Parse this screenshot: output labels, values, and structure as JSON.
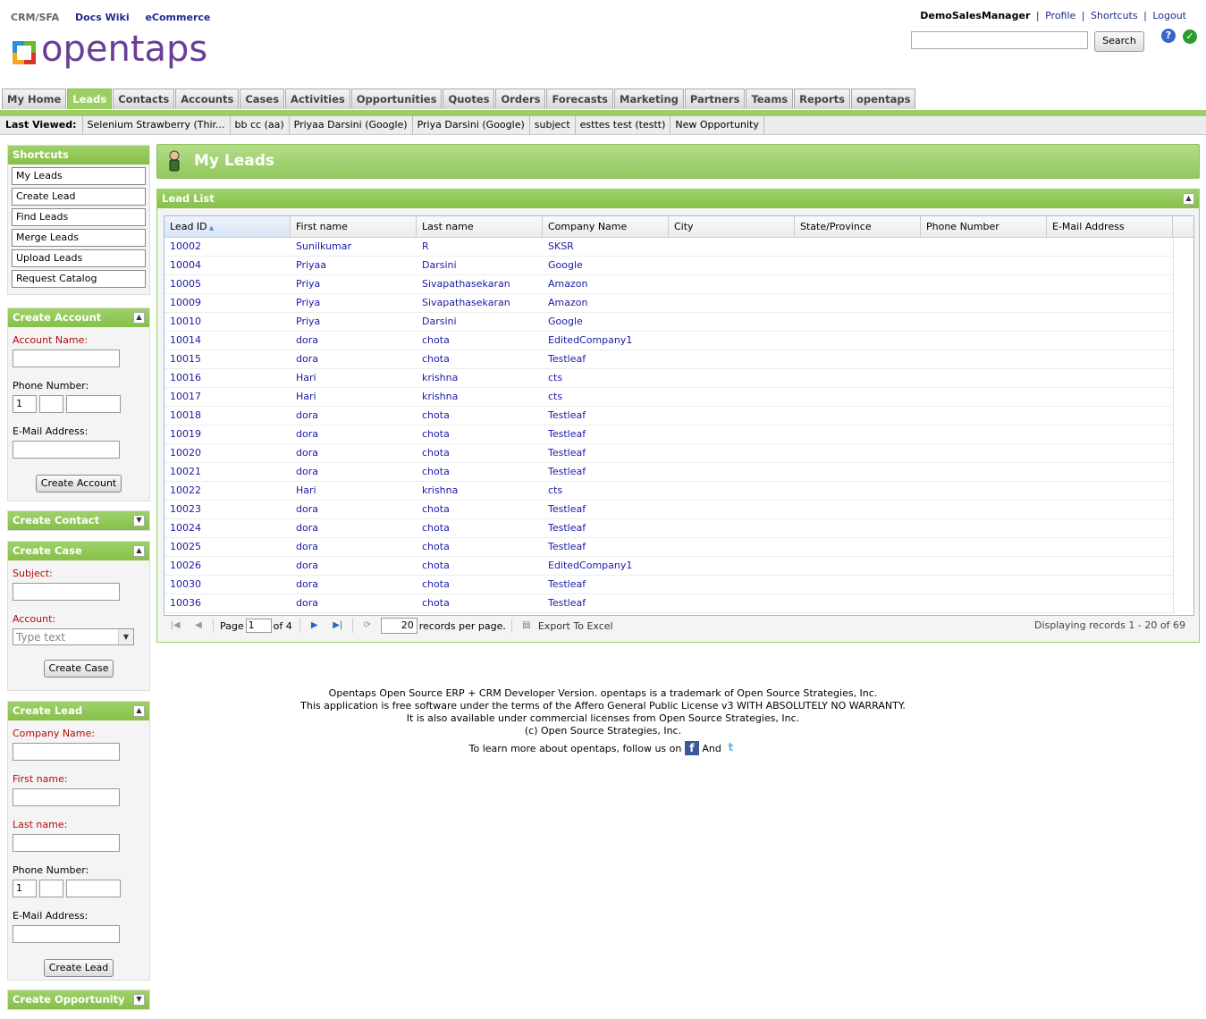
{
  "top_links": [
    "CRM/SFA",
    "Docs Wiki",
    "eCommerce"
  ],
  "logo_text": "opentaps",
  "user_bar": {
    "user": "DemoSalesManager",
    "links": [
      "Profile",
      "Shortcuts",
      "Logout"
    ]
  },
  "search": {
    "button_label": "Search",
    "value": ""
  },
  "tabs": [
    {
      "label": "My Home"
    },
    {
      "label": "Leads",
      "active": true
    },
    {
      "label": "Contacts"
    },
    {
      "label": "Accounts"
    },
    {
      "label": "Cases"
    },
    {
      "label": "Activities"
    },
    {
      "label": "Opportunities"
    },
    {
      "label": "Quotes"
    },
    {
      "label": "Orders"
    },
    {
      "label": "Forecasts"
    },
    {
      "label": "Marketing"
    },
    {
      "label": "Partners"
    },
    {
      "label": "Teams"
    },
    {
      "label": "Reports"
    },
    {
      "label": "opentaps"
    }
  ],
  "last_viewed": {
    "label": "Last Viewed:",
    "items": [
      "Selenium Strawberry (Thir...",
      "bb cc (aa)",
      "Priyaa Darsini (Google)",
      "Priya Darsini (Google)",
      "subject",
      "esttes test (testt)",
      "New Opportunity"
    ]
  },
  "shortcuts": {
    "title": "Shortcuts",
    "items": [
      "My Leads",
      "Create Lead",
      "Find Leads",
      "Merge Leads",
      "Upload Leads",
      "Request Catalog"
    ]
  },
  "create_account": {
    "title": "Create Account",
    "account_name_label": "Account Name:",
    "phone_label": "Phone Number:",
    "phone_country_code": "1",
    "email_label": "E-Mail Address:",
    "button": "Create Account"
  },
  "create_contact": {
    "title": "Create Contact"
  },
  "create_case": {
    "title": "Create Case",
    "subject_label": "Subject:",
    "account_label": "Account:",
    "account_placeholder": "Type text",
    "button": "Create Case"
  },
  "create_lead": {
    "title": "Create Lead",
    "company_label": "Company Name:",
    "first_name_label": "First name:",
    "last_name_label": "Last name:",
    "phone_label": "Phone Number:",
    "phone_country_code": "1",
    "email_label": "E-Mail Address:",
    "button": "Create Lead"
  },
  "create_opportunity": {
    "title": "Create Opportunity"
  },
  "page_title": "My Leads",
  "lead_list": {
    "title": "Lead List",
    "columns": [
      "Lead ID",
      "First name",
      "Last name",
      "Company Name",
      "City",
      "State/Province",
      "Phone Number",
      "E-Mail Address"
    ],
    "rows": [
      [
        "10002",
        "Sunilkumar",
        "R",
        "SKSR"
      ],
      [
        "10004",
        "Priyaa",
        "Darsini",
        "Google"
      ],
      [
        "10005",
        "Priya",
        "Sivapathasekaran",
        "Amazon"
      ],
      [
        "10009",
        "Priya",
        "Sivapathasekaran",
        "Amazon"
      ],
      [
        "10010",
        "Priya",
        "Darsini",
        "Google"
      ],
      [
        "10014",
        "dora",
        "chota",
        "EditedCompany1"
      ],
      [
        "10015",
        "dora",
        "chota",
        "Testleaf"
      ],
      [
        "10016",
        "Hari",
        "krishna",
        "cts"
      ],
      [
        "10017",
        "Hari",
        "krishna",
        "cts"
      ],
      [
        "10018",
        "dora",
        "chota",
        "Testleaf"
      ],
      [
        "10019",
        "dora",
        "chota",
        "Testleaf"
      ],
      [
        "10020",
        "dora",
        "chota",
        "Testleaf"
      ],
      [
        "10021",
        "dora",
        "chota",
        "Testleaf"
      ],
      [
        "10022",
        "Hari",
        "krishna",
        "cts"
      ],
      [
        "10023",
        "dora",
        "chota",
        "Testleaf"
      ],
      [
        "10024",
        "dora",
        "chota",
        "Testleaf"
      ],
      [
        "10025",
        "dora",
        "chota",
        "Testleaf"
      ],
      [
        "10026",
        "dora",
        "chota",
        "EditedCompany1"
      ],
      [
        "10030",
        "dora",
        "chota",
        "Testleaf"
      ],
      [
        "10036",
        "dora",
        "chota",
        "Testleaf"
      ]
    ],
    "pager": {
      "page_label": "Page",
      "page": "1",
      "of_label": "of 4",
      "per_page": "20",
      "per_page_label": "records per page.",
      "export_label": "Export To Excel",
      "display_info": "Displaying records 1 - 20 of 69"
    }
  },
  "footer": {
    "line1": "Opentaps Open Source ERP + CRM Developer Version. opentaps is a trademark of Open Source Strategies, Inc.",
    "line2": "This application is free software under the terms of the Affero General Public License v3 WITH ABSOLUTELY NO WARRANTY.",
    "line3": "It is also available under commercial licenses from Open Source Strategies, Inc.",
    "line4": "(c) Open Source Strategies, Inc.",
    "follow_prefix": "To learn more about opentaps, follow us on",
    "follow_and": "And"
  },
  "colors": {
    "accent_green": "#9bcf62",
    "link_blue": "#1e2b8c",
    "required_red": "#b50a0a",
    "logo_purple": "#6a3d96"
  }
}
